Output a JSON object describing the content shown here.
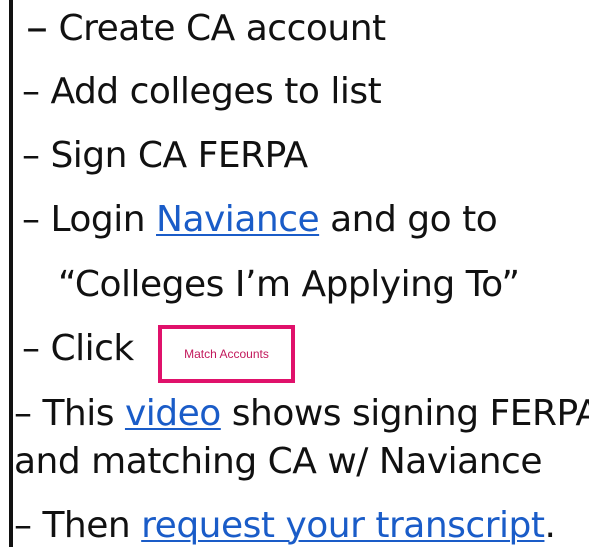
{
  "steps": {
    "step1": {
      "dash": "–",
      "text": " Create CA account"
    },
    "step2": {
      "dash": "–",
      "text": " Add colleges to list"
    },
    "step3": {
      "dash": "–",
      "text": " Sign CA FERPA"
    },
    "step4": {
      "dash": "–",
      "prefix": " Login ",
      "link": "Naviance",
      "suffix": " and go to"
    },
    "step4b": {
      "text": "“Colleges I’m Applying To”"
    },
    "step5": {
      "dash": "–",
      "text": " Click"
    },
    "step6": {
      "dash": "–",
      "prefix": " This ",
      "link": "video",
      "suffix": " shows signing FERPA"
    },
    "step6b": {
      "text": "and matching CA w/ Naviance"
    },
    "step7": {
      "dash": "–",
      "prefix": " Then ",
      "link": "request your transcript",
      "suffix": "."
    }
  },
  "match_button": {
    "label": "Match Accounts"
  },
  "colors": {
    "link": "#1a5cc8",
    "button_border": "#e0116b",
    "button_text": "#c2185b",
    "text": "#111111"
  }
}
